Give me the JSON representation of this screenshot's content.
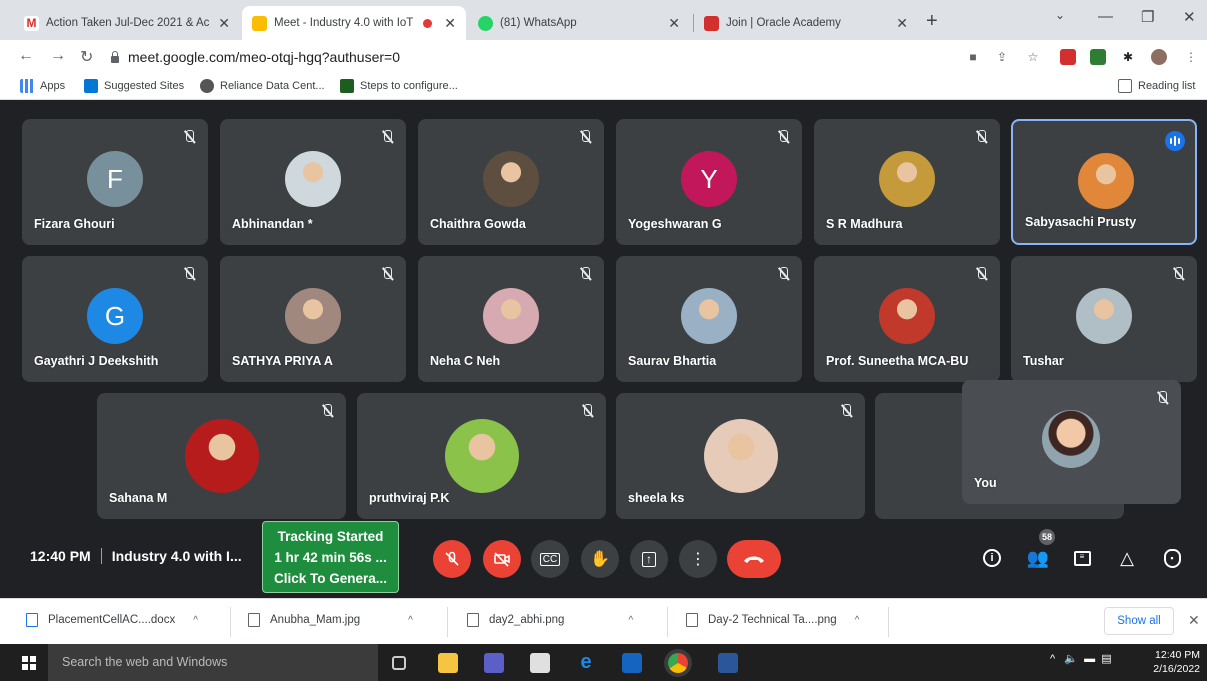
{
  "browser": {
    "tabs": [
      {
        "label": "Action Taken Jul-Dec 2021 & Ac",
        "active": false
      },
      {
        "label": "Meet - Industry 4.0 with IoT",
        "active": true
      },
      {
        "label": "(81) WhatsApp",
        "active": false
      },
      {
        "label": "Join | Oracle Academy",
        "active": false
      }
    ],
    "url": "meet.google.com/meo-otqj-hgq?authuser=0",
    "bookmarks": [
      "Apps",
      "Suggested Sites",
      "Reliance Data Cent...",
      "Steps to configure..."
    ],
    "reading_list": "Reading list"
  },
  "meet": {
    "participants": [
      {
        "name": "Fizara Ghouri",
        "initial": "F",
        "avatar_color": "#78909c"
      },
      {
        "name": "Abhinandan *",
        "initial": "",
        "avatar_color": "#cfd8dc"
      },
      {
        "name": "Chaithra Gowda",
        "initial": "",
        "avatar_color": "#5d4e3f"
      },
      {
        "name": "Yogeshwaran G",
        "initial": "Y",
        "avatar_color": "#c2185b"
      },
      {
        "name": "S R Madhura",
        "initial": "",
        "avatar_color": "#c49a3a"
      },
      {
        "name": "Sabyasachi Prusty",
        "initial": "",
        "avatar_color": "#e0873a"
      },
      {
        "name": "Gayathri J Deekshith",
        "initial": "G",
        "avatar_color": "#1e88e5"
      },
      {
        "name": "SATHYA PRIYA A",
        "initial": "",
        "avatar_color": "#a1887f"
      },
      {
        "name": "Neha C Neh",
        "initial": "",
        "avatar_color": "#d7a9b0"
      },
      {
        "name": "Saurav Bhartia",
        "initial": "",
        "avatar_color": "#9ab0c4"
      },
      {
        "name": "Prof. Suneetha MCA-BU",
        "initial": "",
        "avatar_color": "#c0392b"
      },
      {
        "name": "Tushar",
        "initial": "",
        "avatar_color": "#b0bec5"
      },
      {
        "name": "Sahana M",
        "initial": "",
        "avatar_color": "#b71c1c"
      },
      {
        "name": "pruthviraj P.K",
        "initial": "",
        "avatar_color": "#8bc34a"
      },
      {
        "name": "sheela ks",
        "initial": "",
        "avatar_color": "#e6cbb8"
      }
    ],
    "self_label": "You",
    "clock": "12:40 PM",
    "meeting_title": "Industry 4.0 with I...",
    "tracking": [
      "Tracking Started",
      "1 hr 42 min 56s ...",
      "Click To Genera..."
    ],
    "participant_count": "58"
  },
  "downloads": {
    "items": [
      "PlacementCellAC....docx",
      "Anubha_Mam.jpg",
      "day2_abhi.png",
      "Day-2 Technical Ta....png"
    ],
    "show_all": "Show all"
  },
  "taskbar": {
    "search_placeholder": "Search the web and Windows",
    "time": "12:40 PM",
    "date": "2/16/2022"
  },
  "colors": {
    "meet_bg": "#202124",
    "tile_bg": "#3c4043",
    "danger": "#ea4335",
    "accent": "#1a73e8",
    "tracking_bg": "#1e8e3e"
  }
}
